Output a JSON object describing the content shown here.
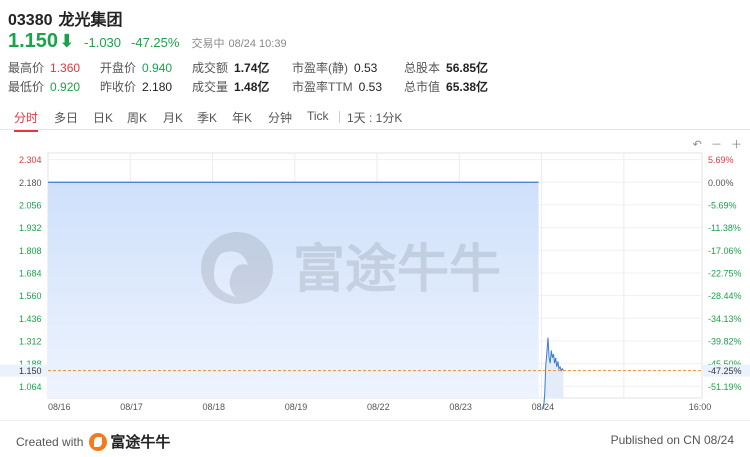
{
  "stock": {
    "code": "03380",
    "name": "龙光集团",
    "price": "1.150",
    "arrow": "⬇",
    "change": "-1.030",
    "change_pct": "-47.25%",
    "status": "交易中",
    "time": "08/24 10:39"
  },
  "stats": [
    {
      "label": "最高价",
      "value": "1.360",
      "tone": "up"
    },
    {
      "label": "开盘价",
      "value": "0.940",
      "tone": "dn"
    },
    {
      "label": "成交额",
      "value": "1.74亿",
      "tone": "b"
    },
    {
      "label": "市盈率(静)",
      "value": "0.53",
      "tone": "nt"
    },
    {
      "label": "总股本",
      "value": "56.85亿",
      "tone": "b"
    },
    {
      "label": "最低价",
      "value": "0.920",
      "tone": "dn"
    },
    {
      "label": "昨收价",
      "value": "2.180",
      "tone": "nt"
    },
    {
      "label": "成交量",
      "value": "1.48亿",
      "tone": "b"
    },
    {
      "label": "市盈率TTM",
      "value": "0.53",
      "tone": "nt"
    },
    {
      "label": "总市值",
      "value": "65.38亿",
      "tone": "b"
    }
  ],
  "tabs": [
    "分时",
    "多日",
    "日K",
    "周K",
    "月K",
    "季K",
    "年K",
    "分钟",
    "Tick",
    "1天 : 1分K"
  ],
  "tools": {
    "undo": "↶",
    "minus": "－",
    "plus": "＋"
  },
  "watermark": "富途牛牛",
  "colors": {
    "up": "#e0383e",
    "down": "#1aa34a",
    "line": "#3a7bd5",
    "prev_close": "#f08c28"
  },
  "chart_data": {
    "type": "line",
    "price_ticks": [
      "2.304",
      "2.180",
      "2.056",
      "1.932",
      "1.808",
      "1.684",
      "1.560",
      "1.436",
      "1.312",
      "1.188",
      "1.064"
    ],
    "pct_ticks": [
      "5.69%",
      "0.00%",
      "-5.69%",
      "-11.38%",
      "-17.06%",
      "-22.75%",
      "-28.44%",
      "-34.13%",
      "-39.82%",
      "-45.50%",
      "-51.19%"
    ],
    "current_price_label": "1.150",
    "current_pct_label": "-47.25%",
    "x_labels": [
      "08/16",
      "08/17",
      "08/18",
      "08/19",
      "08/22",
      "08/23",
      "08/24",
      "16:00"
    ],
    "ylim": [
      1.0,
      2.34
    ],
    "prev_close": 2.18,
    "current": 1.15,
    "history": {
      "from_day": 0,
      "to_day": 6,
      "value": 2.18
    },
    "today": [
      0.94,
      1.02,
      1.18,
      1.25,
      1.33,
      1.22,
      1.19,
      1.26,
      1.22,
      1.24,
      1.19,
      1.22,
      1.17,
      1.2,
      1.16,
      1.17,
      1.15,
      1.16,
      1.15
    ]
  },
  "footer": {
    "created": "Created with",
    "brand": "富途牛牛",
    "published": "Published on CN 08/24"
  }
}
